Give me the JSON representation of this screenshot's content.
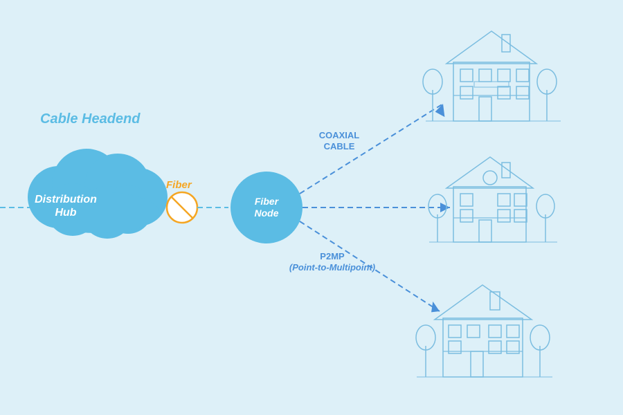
{
  "labels": {
    "cable_headend": "Cable Headend",
    "distribution_hub": "Distribution Hub",
    "fiber": "Fiber",
    "fiber_node": "Fiber Node",
    "coaxial_cable": "COAXIAL\nCABLE",
    "p2mp": "P2MP\n(Point-to-Multipoint)"
  },
  "colors": {
    "background": "#def0f8",
    "cloud_fill": "#5bbce4",
    "cloud_stroke": "#4aa8d0",
    "fiber_node_fill": "#5bbce4",
    "fiber_color": "#f5a623",
    "label_blue": "#4a90d9",
    "label_cyan": "#5bbce4",
    "text_white": "#ffffff",
    "arrow_color": "#4a90d9",
    "house_stroke": "#7bbde0",
    "dashed_line": "#5bbce4"
  }
}
